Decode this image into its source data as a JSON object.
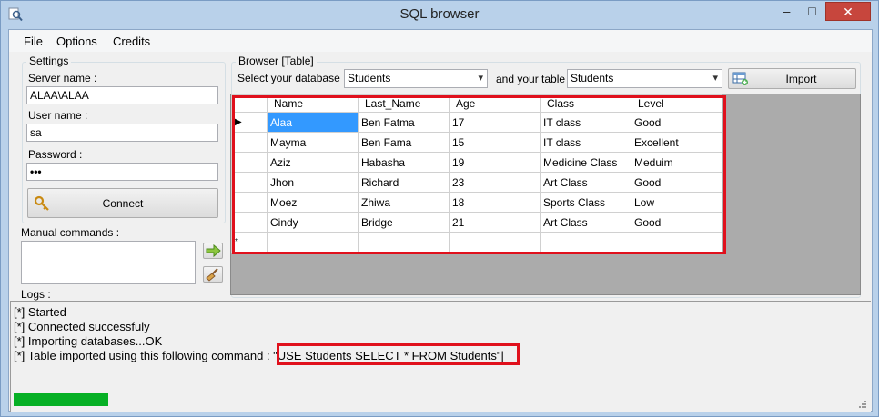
{
  "window": {
    "title": "SQL browser",
    "controls": {
      "minimize": "–",
      "maximize": "□",
      "close": "✕"
    }
  },
  "menu": {
    "items": [
      "File",
      "Options",
      "Credits"
    ]
  },
  "settings": {
    "legend": "Settings",
    "server_label": "Server name :",
    "server_value": "ALAA\\ALAA",
    "user_label": "User name :",
    "user_value": "sa",
    "password_label": "Password :",
    "password_value": "•••",
    "connect_label": "Connect",
    "connect_icon": "key-icon"
  },
  "manual": {
    "label": "Manual commands :",
    "send_icon": "arrow-right-icon",
    "clear_icon": "broom-icon"
  },
  "browser": {
    "legend": "Browser [Table]",
    "db_label": "Select your database :",
    "db_value": "Students",
    "table_label": "and your table :",
    "table_value": "Students",
    "import_label": "Import",
    "import_icon": "table-add-icon"
  },
  "grid": {
    "columns": [
      "Name",
      "Last_Name",
      "Age",
      "Class",
      "Level"
    ],
    "rows": [
      [
        "Alaa",
        "Ben Fatma",
        "17",
        "IT class",
        "Good"
      ],
      [
        "Mayma",
        "Ben Fama",
        "15",
        "IT class",
        "Excellent"
      ],
      [
        "Aziz",
        "Habasha",
        "19",
        "Medicine Class",
        "Meduim"
      ],
      [
        "Jhon",
        "Richard",
        "23",
        "Art Class",
        "Good"
      ],
      [
        "Moez",
        "Zhiwa",
        "18",
        "Sports Class",
        "Low"
      ],
      [
        "Cindy",
        "Bridge",
        "21",
        "Art Class",
        "Good"
      ]
    ],
    "current_row_marker": "▶",
    "new_row_marker": "*"
  },
  "logs": {
    "label": "Logs :",
    "lines": [
      "[*] Started",
      "[*] Connected successfuly",
      "[*] Importing databases...OK",
      "[*] Table imported using this following command : \"USE Students SELECT * FROM Students\"|"
    ],
    "progress": 0.11
  },
  "colors": {
    "titlebar": "#b9d1ea",
    "highlight": "#e0101c",
    "selection": "#3399ff",
    "progress": "#06b025",
    "close": "#c7463d"
  }
}
